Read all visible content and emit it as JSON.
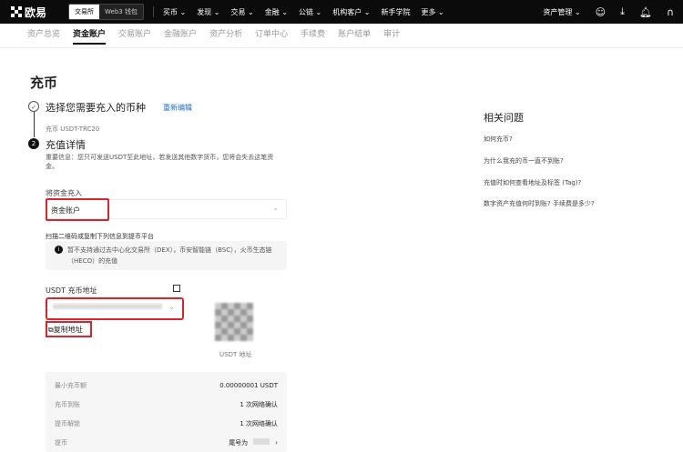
{
  "topbar": {
    "logo": "欧易",
    "seg": [
      "交易所",
      "Web3 钱包"
    ],
    "nav": [
      "买币 ⌄",
      "发现 ⌄",
      "交易 ⌄",
      "金融 ⌄",
      "公链 ⌄",
      "机构客户 ⌄",
      "新手学院",
      "更多 ⌄"
    ],
    "asset_mgmt": "资产管理 ⌄"
  },
  "subnav": [
    "资产总览",
    "资金账户",
    "交易账户",
    "金融账户",
    "资产分析",
    "订单中心",
    "手续费",
    "账户结单",
    "审计"
  ],
  "title": "充币",
  "step1": {
    "label": "选择您需要充入的币种",
    "edit": "重新编辑",
    "sub": "充币 USDT-TRC20"
  },
  "step2": {
    "num": "2",
    "label": "充值详情",
    "warning": "重要信息：您只可发送USDT至此地址，若发送其他数字货币，您将会失去这笔资金。"
  },
  "account": {
    "label": "将资金充入",
    "value": "资金账户"
  },
  "scan_label": "扫描二维码或复制下列信息到提币平台",
  "notice": "暂不支持通过去中心化交易所（DEX），币安智能链（BSC），火币生态链（HECO）的充值",
  "address": {
    "label": "USDT 充币地址",
    "copy": "复制地址",
    "qr_caption": "USDT 地址"
  },
  "info": [
    {
      "k": "最小充币额",
      "v": "0.00000001 USDT"
    },
    {
      "k": "充币到账",
      "v": "1 次网络确认"
    },
    {
      "k": "提币解锁",
      "v": "1 次网络确认"
    },
    {
      "k": "提币",
      "v": "尾号为"
    }
  ],
  "faq": {
    "title": "相关问题",
    "items": [
      "如何充币?",
      "为什么我充的币一直不到账?",
      "充值时如何查看地址及标签 (Tag)?",
      "数字资产充值何时到账? 手续费是多少?"
    ]
  },
  "colors": {
    "highlight": "#d9262c",
    "topbar": "#0b0b0b",
    "link": "#1f6fd1"
  }
}
